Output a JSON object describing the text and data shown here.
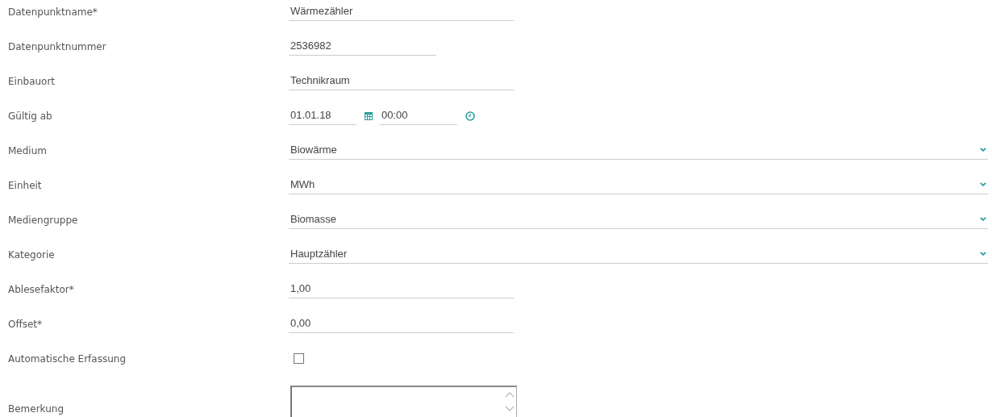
{
  "fields": [
    {
      "kind": "text",
      "label": "Datenpunktname*",
      "value": "Wärmezähler"
    },
    {
      "kind": "number",
      "label": "Datenpunktnummer",
      "value": "2536982"
    },
    {
      "kind": "text",
      "label": "Einbauort",
      "value": "Technikraum"
    },
    {
      "kind": "datetime",
      "label": "Gültig ab",
      "date": "01.01.18",
      "time": "00:00"
    },
    {
      "kind": "select",
      "label": "Medium",
      "value": "Biowärme"
    },
    {
      "kind": "select",
      "label": "Einheit",
      "value": "MWh"
    },
    {
      "kind": "select",
      "label": "Mediengruppe",
      "value": "Biomasse"
    },
    {
      "kind": "select",
      "label": "Kategorie",
      "value": "Hauptzähler"
    },
    {
      "kind": "text",
      "label": "Ablesefaktor*",
      "value": "1,00"
    },
    {
      "kind": "text",
      "label": "Offset*",
      "value": "0,00"
    },
    {
      "kind": "checkbox",
      "label": "Automatische Erfassung",
      "checked": false
    },
    {
      "kind": "textarea",
      "label": "Bemerkung"
    }
  ]
}
